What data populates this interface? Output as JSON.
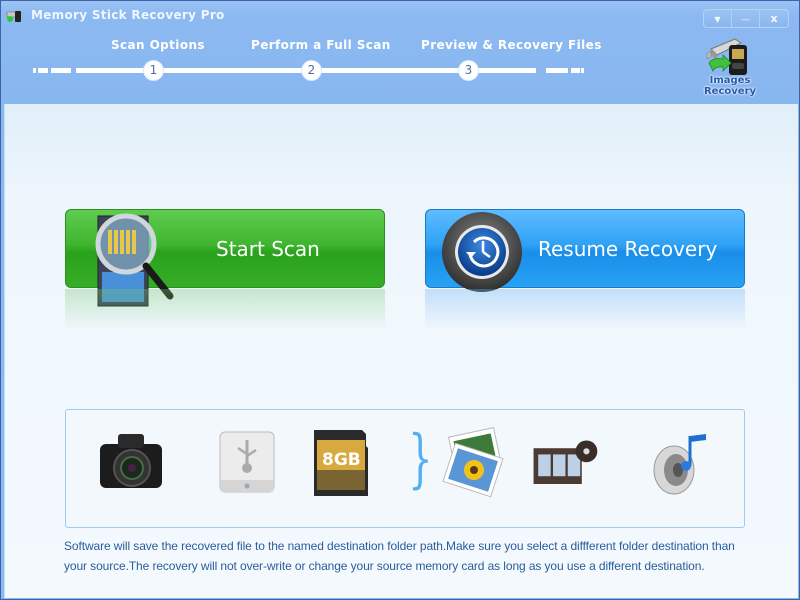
{
  "window": {
    "title": "Memory Stick Recovery Pro",
    "controls": [
      {
        "name": "menu-dropdown",
        "icon": "triangle-down-icon",
        "glyph": "▼"
      },
      {
        "name": "minimize",
        "icon": "minimize-icon",
        "glyph": "—"
      },
      {
        "name": "close",
        "icon": "close-icon",
        "glyph": "x"
      }
    ]
  },
  "steps": [
    {
      "number": "1",
      "label": "Scan Options"
    },
    {
      "number": "2",
      "label": "Perform a Full Scan"
    },
    {
      "number": "3",
      "label": "Preview & Recovery Files"
    }
  ],
  "images_recovery": {
    "line1": "Images",
    "line2": "Recovery"
  },
  "actions": {
    "start_scan": "Start Scan",
    "resume_recovery": "Resume Recovery"
  },
  "devices": [
    {
      "name": "camera",
      "icon": "camera-icon"
    },
    {
      "name": "usb-drive",
      "icon": "usb-drive-icon"
    },
    {
      "name": "sd-card",
      "icon": "sd-card-icon",
      "label": "8GB"
    },
    {
      "name": "photos",
      "icon": "photo-icon"
    },
    {
      "name": "video",
      "icon": "film-icon"
    },
    {
      "name": "audio",
      "icon": "speaker-music-icon"
    }
  ],
  "colors": {
    "header_bg": "#88b6ef",
    "start_green": "#3fb62f",
    "resume_blue": "#2fa2f5",
    "info_text": "#2a5d9a"
  },
  "info_text": "Software will save the recovered file to the named destination folder path.Make sure you select a diffferent folder destination than your source.The recovery will not over-write or change your source memory card as long as you use a different destination."
}
